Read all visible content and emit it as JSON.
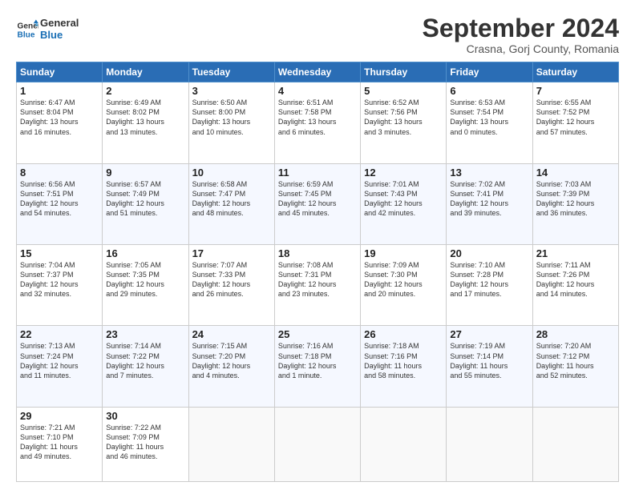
{
  "header": {
    "logo_line1": "General",
    "logo_line2": "Blue",
    "title": "September 2024",
    "subtitle": "Crasna, Gorj County, Romania"
  },
  "columns": [
    "Sunday",
    "Monday",
    "Tuesday",
    "Wednesday",
    "Thursday",
    "Friday",
    "Saturday"
  ],
  "weeks": [
    [
      {
        "day": "1",
        "lines": [
          "Sunrise: 6:47 AM",
          "Sunset: 8:04 PM",
          "Daylight: 13 hours",
          "and 16 minutes."
        ]
      },
      {
        "day": "2",
        "lines": [
          "Sunrise: 6:49 AM",
          "Sunset: 8:02 PM",
          "Daylight: 13 hours",
          "and 13 minutes."
        ]
      },
      {
        "day": "3",
        "lines": [
          "Sunrise: 6:50 AM",
          "Sunset: 8:00 PM",
          "Daylight: 13 hours",
          "and 10 minutes."
        ]
      },
      {
        "day": "4",
        "lines": [
          "Sunrise: 6:51 AM",
          "Sunset: 7:58 PM",
          "Daylight: 13 hours",
          "and 6 minutes."
        ]
      },
      {
        "day": "5",
        "lines": [
          "Sunrise: 6:52 AM",
          "Sunset: 7:56 PM",
          "Daylight: 13 hours",
          "and 3 minutes."
        ]
      },
      {
        "day": "6",
        "lines": [
          "Sunrise: 6:53 AM",
          "Sunset: 7:54 PM",
          "Daylight: 13 hours",
          "and 0 minutes."
        ]
      },
      {
        "day": "7",
        "lines": [
          "Sunrise: 6:55 AM",
          "Sunset: 7:52 PM",
          "Daylight: 12 hours",
          "and 57 minutes."
        ]
      }
    ],
    [
      {
        "day": "8",
        "lines": [
          "Sunrise: 6:56 AM",
          "Sunset: 7:51 PM",
          "Daylight: 12 hours",
          "and 54 minutes."
        ]
      },
      {
        "day": "9",
        "lines": [
          "Sunrise: 6:57 AM",
          "Sunset: 7:49 PM",
          "Daylight: 12 hours",
          "and 51 minutes."
        ]
      },
      {
        "day": "10",
        "lines": [
          "Sunrise: 6:58 AM",
          "Sunset: 7:47 PM",
          "Daylight: 12 hours",
          "and 48 minutes."
        ]
      },
      {
        "day": "11",
        "lines": [
          "Sunrise: 6:59 AM",
          "Sunset: 7:45 PM",
          "Daylight: 12 hours",
          "and 45 minutes."
        ]
      },
      {
        "day": "12",
        "lines": [
          "Sunrise: 7:01 AM",
          "Sunset: 7:43 PM",
          "Daylight: 12 hours",
          "and 42 minutes."
        ]
      },
      {
        "day": "13",
        "lines": [
          "Sunrise: 7:02 AM",
          "Sunset: 7:41 PM",
          "Daylight: 12 hours",
          "and 39 minutes."
        ]
      },
      {
        "day": "14",
        "lines": [
          "Sunrise: 7:03 AM",
          "Sunset: 7:39 PM",
          "Daylight: 12 hours",
          "and 36 minutes."
        ]
      }
    ],
    [
      {
        "day": "15",
        "lines": [
          "Sunrise: 7:04 AM",
          "Sunset: 7:37 PM",
          "Daylight: 12 hours",
          "and 32 minutes."
        ]
      },
      {
        "day": "16",
        "lines": [
          "Sunrise: 7:05 AM",
          "Sunset: 7:35 PM",
          "Daylight: 12 hours",
          "and 29 minutes."
        ]
      },
      {
        "day": "17",
        "lines": [
          "Sunrise: 7:07 AM",
          "Sunset: 7:33 PM",
          "Daylight: 12 hours",
          "and 26 minutes."
        ]
      },
      {
        "day": "18",
        "lines": [
          "Sunrise: 7:08 AM",
          "Sunset: 7:31 PM",
          "Daylight: 12 hours",
          "and 23 minutes."
        ]
      },
      {
        "day": "19",
        "lines": [
          "Sunrise: 7:09 AM",
          "Sunset: 7:30 PM",
          "Daylight: 12 hours",
          "and 20 minutes."
        ]
      },
      {
        "day": "20",
        "lines": [
          "Sunrise: 7:10 AM",
          "Sunset: 7:28 PM",
          "Daylight: 12 hours",
          "and 17 minutes."
        ]
      },
      {
        "day": "21",
        "lines": [
          "Sunrise: 7:11 AM",
          "Sunset: 7:26 PM",
          "Daylight: 12 hours",
          "and 14 minutes."
        ]
      }
    ],
    [
      {
        "day": "22",
        "lines": [
          "Sunrise: 7:13 AM",
          "Sunset: 7:24 PM",
          "Daylight: 12 hours",
          "and 11 minutes."
        ]
      },
      {
        "day": "23",
        "lines": [
          "Sunrise: 7:14 AM",
          "Sunset: 7:22 PM",
          "Daylight: 12 hours",
          "and 7 minutes."
        ]
      },
      {
        "day": "24",
        "lines": [
          "Sunrise: 7:15 AM",
          "Sunset: 7:20 PM",
          "Daylight: 12 hours",
          "and 4 minutes."
        ]
      },
      {
        "day": "25",
        "lines": [
          "Sunrise: 7:16 AM",
          "Sunset: 7:18 PM",
          "Daylight: 12 hours",
          "and 1 minute."
        ]
      },
      {
        "day": "26",
        "lines": [
          "Sunrise: 7:18 AM",
          "Sunset: 7:16 PM",
          "Daylight: 11 hours",
          "and 58 minutes."
        ]
      },
      {
        "day": "27",
        "lines": [
          "Sunrise: 7:19 AM",
          "Sunset: 7:14 PM",
          "Daylight: 11 hours",
          "and 55 minutes."
        ]
      },
      {
        "day": "28",
        "lines": [
          "Sunrise: 7:20 AM",
          "Sunset: 7:12 PM",
          "Daylight: 11 hours",
          "and 52 minutes."
        ]
      }
    ],
    [
      {
        "day": "29",
        "lines": [
          "Sunrise: 7:21 AM",
          "Sunset: 7:10 PM",
          "Daylight: 11 hours",
          "and 49 minutes."
        ]
      },
      {
        "day": "30",
        "lines": [
          "Sunrise: 7:22 AM",
          "Sunset: 7:09 PM",
          "Daylight: 11 hours",
          "and 46 minutes."
        ]
      },
      {
        "day": "",
        "lines": []
      },
      {
        "day": "",
        "lines": []
      },
      {
        "day": "",
        "lines": []
      },
      {
        "day": "",
        "lines": []
      },
      {
        "day": "",
        "lines": []
      }
    ]
  ]
}
